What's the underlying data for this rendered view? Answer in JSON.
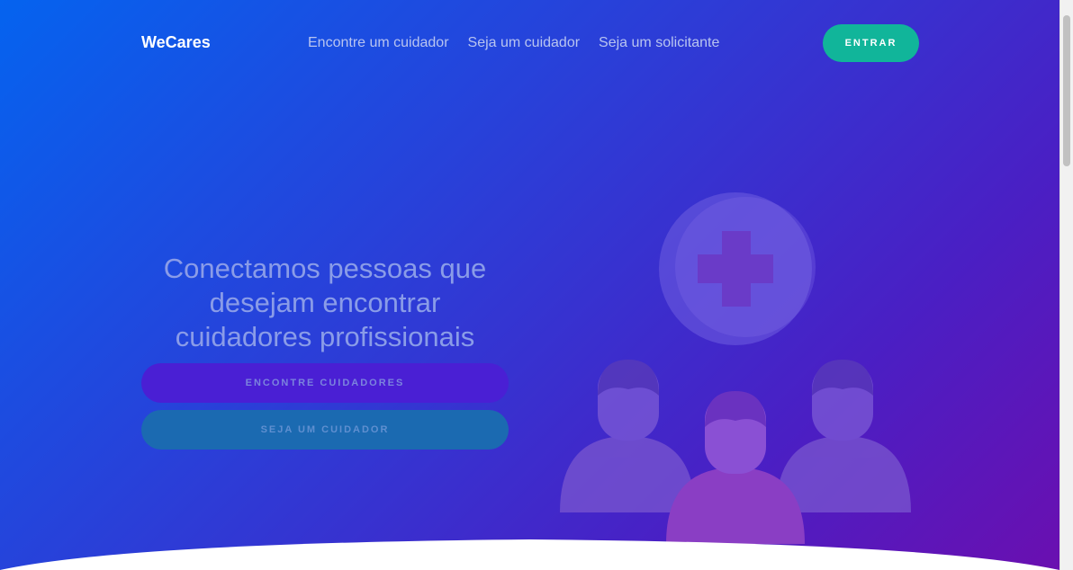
{
  "header": {
    "brand": "WeCares",
    "nav": [
      {
        "label": "Encontre um cuidador"
      },
      {
        "label": "Seja um cuidador"
      },
      {
        "label": "Seja um solicitante"
      }
    ],
    "login_label": "ENTRAR"
  },
  "hero": {
    "headline": "Conectamos pessoas que desejam encontrar cuidadores profissionais",
    "cta_find": "ENCONTRE CUIDADORES",
    "cta_be": "SEJA UM CUIDADOR"
  },
  "colors": {
    "accent_green": "#11b59a",
    "gradient_start": "#0563ef",
    "gradient_end": "#6a0fb0"
  },
  "icons": [
    "medical-cross-icon",
    "people-illustration"
  ]
}
